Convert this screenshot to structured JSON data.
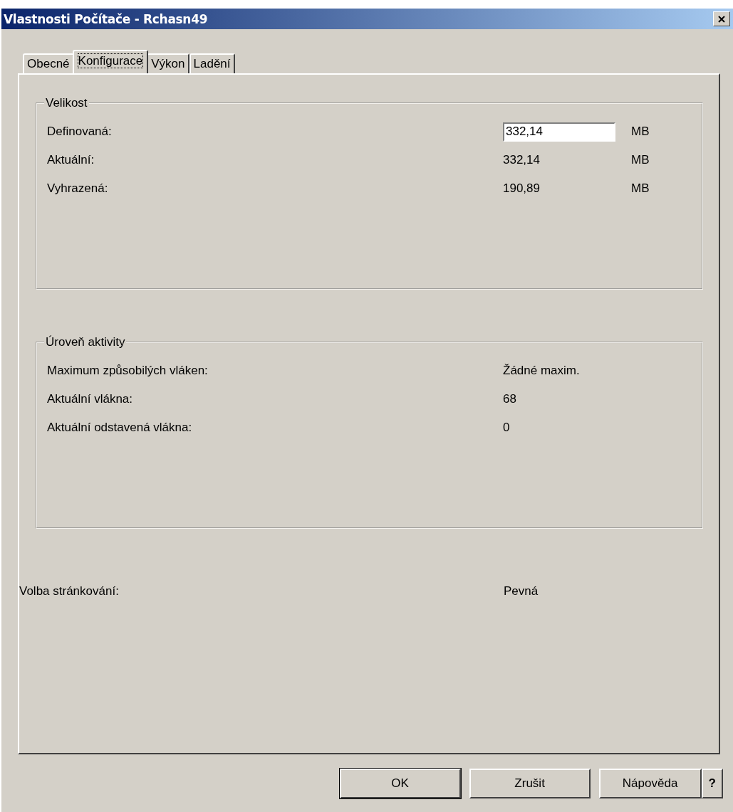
{
  "window": {
    "title": "Vlastnosti Počítače - Rchasn49"
  },
  "tabs": [
    {
      "label": "Obecné",
      "selected": false
    },
    {
      "label": "Konfigurace",
      "selected": true
    },
    {
      "label": "Výkon",
      "selected": false
    },
    {
      "label": "Ladění",
      "selected": false
    }
  ],
  "groups": [
    {
      "legend": "Velikost",
      "rows": [
        {
          "label": "Definovaná:",
          "kind": "input",
          "value": "332,14",
          "unit": "MB"
        },
        {
          "label": "Aktuální:",
          "kind": "text",
          "value": "332,14",
          "unit": "MB"
        },
        {
          "label": "Vyhrazená:",
          "kind": "text",
          "value": "190,89",
          "unit": "MB"
        }
      ]
    },
    {
      "legend": "Úroveň aktivity",
      "rows": [
        {
          "label": "Maximum způsobilých vláken:",
          "kind": "text",
          "value": "Žádné maxim."
        },
        {
          "label": "Aktuální vlákna:",
          "kind": "text",
          "value": "68"
        },
        {
          "label": "Aktuální odstavená vlákna:",
          "kind": "text",
          "value": "0"
        }
      ]
    }
  ],
  "paging": {
    "label": "Volba stránkování:",
    "value": "Pevná"
  },
  "buttons": [
    {
      "label": "OK",
      "kind": "default"
    },
    {
      "label": "Zrušit",
      "kind": "normal"
    },
    {
      "label": "Nápověda",
      "kind": "normal"
    },
    {
      "label": "?",
      "kind": "help"
    }
  ]
}
